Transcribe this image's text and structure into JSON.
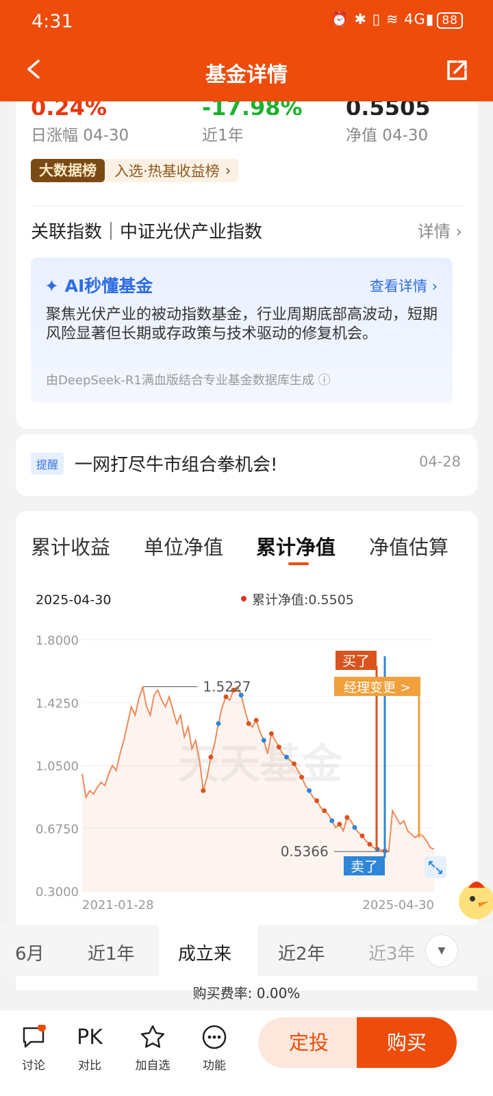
{
  "status_bar": {
    "time": "4:31",
    "icons": "⏰ ✱ ▯ ≋ 4G▮",
    "battery": "88"
  },
  "header": {
    "title": "基金详情"
  },
  "stats": [
    {
      "value": "0.24%",
      "label": "日涨幅 04-30",
      "color": "#e8380f"
    },
    {
      "value": "-17.98%",
      "label": "近1年",
      "color": "#1db12d"
    },
    {
      "value": "0.5505",
      "label": "净值 04-30",
      "color": "#222222"
    }
  ],
  "rank": {
    "tag": "大数据榜",
    "text": "入选·热基收益榜",
    "arrow": "›"
  },
  "index": {
    "label": "关联指数｜中证光伏产业指数",
    "detail": "详情 ›"
  },
  "ai": {
    "title": "AI秒懂基金",
    "link": "查看详情 ›",
    "body": "聚焦光伏产业的被动指数基金，行业周期底部高波动，短期风险显著但长期或存政策与技术驱动的修复机会。",
    "source": "由DeepSeek-R1满血版结合专业基金数据库生成 ⓘ"
  },
  "reminder": {
    "tag": "提醒",
    "text": "一网打尽牛市组合拳机会!",
    "date": "04-28"
  },
  "chart_tabs": [
    "累计收益",
    "单位净值",
    "累计净值",
    "净值估算"
  ],
  "active_chart_tab": "累计净值",
  "chart_data": {
    "type": "line",
    "header_date": "2025-04-30",
    "legend": "累计净值:0.5505",
    "yticks": [
      "1.8000",
      "1.4250",
      "1.0500",
      "0.6750",
      "0.3000"
    ],
    "xticks": [
      "2021-01-28",
      "2025-04-30"
    ],
    "ylim": [
      0.3,
      1.8
    ],
    "max_label": "1.5227",
    "min_label": "0.5366",
    "watermark": "天天基金",
    "annotations": {
      "buy": "买了",
      "sell": "卖了",
      "manager": "经理变更 >"
    },
    "series": [
      {
        "values": [
          1.0,
          0.86,
          0.9,
          0.88,
          0.92,
          0.95,
          0.93,
          1.0,
          1.05,
          1.02,
          1.12,
          1.2,
          1.3,
          1.4,
          1.35,
          1.45,
          1.52,
          1.4,
          1.35,
          1.47,
          1.5,
          1.44,
          1.4,
          1.46,
          1.38,
          1.3,
          1.35,
          1.22,
          1.28,
          1.15,
          1.2,
          1.08,
          0.9,
          0.98,
          1.1,
          1.18,
          1.3,
          1.4,
          1.46,
          1.44,
          1.5,
          1.52,
          1.47,
          1.38,
          1.3,
          1.28,
          1.32,
          1.25,
          1.2,
          1.12,
          1.24,
          1.2,
          1.16,
          1.12,
          1.1,
          1.08,
          1.06,
          1.02,
          0.98,
          0.93,
          0.9,
          0.86,
          0.84,
          0.8,
          0.78,
          0.76,
          0.72,
          0.68,
          0.7,
          0.66,
          0.74,
          0.72,
          0.68,
          0.65,
          0.63,
          0.6,
          0.58,
          0.56,
          0.55,
          0.545,
          0.54,
          0.5366,
          0.78,
          0.74,
          0.7,
          0.72,
          0.66,
          0.64,
          0.62,
          0.64,
          0.63,
          0.6,
          0.56,
          0.5505
        ]
      }
    ]
  },
  "ranges": [
    "6月",
    "近1年",
    "成立来",
    "近2年",
    "近3年"
  ],
  "active_range": "成立来",
  "more_icon": "chevron-down-icon",
  "fee": "购买费率: 0.00%",
  "nav": [
    {
      "label": "讨论",
      "icon": "chat-icon"
    },
    {
      "label": "对比",
      "icon": "PK"
    },
    {
      "label": "加自选",
      "icon": "star-icon"
    },
    {
      "label": "功能",
      "icon": "more-icon"
    }
  ],
  "buttons": {
    "sip": "定投",
    "buy": "购买"
  },
  "colors": {
    "brand": "#ee4c0b",
    "up": "#e8380f",
    "down": "#1db12d",
    "line": "#ec8a5a",
    "buy_point": "#d9531e",
    "sell_point": "#2f86d6",
    "manager": "#f0a03c"
  }
}
